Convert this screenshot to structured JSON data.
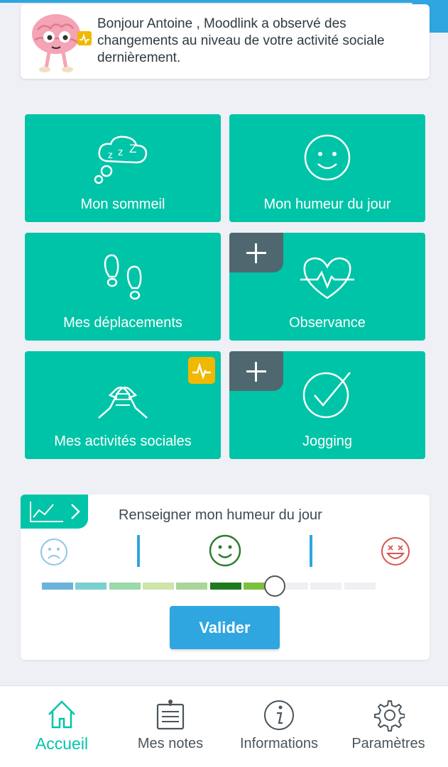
{
  "notification": {
    "message": "Bonjour Antoine , Moodlink a observé des changements au niveau de votre activité sociale dernièrement."
  },
  "tiles": [
    {
      "label": "Mon sommeil",
      "icon": "sleep-cloud-icon",
      "badge": null
    },
    {
      "label": "Mon humeur du jour",
      "icon": "smiley-icon",
      "badge": null
    },
    {
      "label": "Mes déplacements",
      "icon": "footprints-icon",
      "badge": null
    },
    {
      "label": "Observance",
      "icon": "heartbeat-icon",
      "badge": "plus"
    },
    {
      "label": "Mes activités sociales",
      "icon": "handshake-icon",
      "badge": "alert"
    },
    {
      "label": "Jogging",
      "icon": "checkmark-circle-icon",
      "badge": "plus"
    }
  ],
  "mood": {
    "title": "Renseigner mon humeur du jour",
    "scale_icons": [
      "sad-face-icon",
      "neutral-smile-icon",
      "happy-face-icon"
    ],
    "segment_colors": [
      "#6bb3dc",
      "#7ccfd0",
      "#9ad9a8",
      "#cde5a8",
      "#a8d59a",
      "#1f7a1f",
      "#7dc03c",
      "#eef0f4",
      "#eef0f4",
      "#eef0f4"
    ],
    "filled_segments": 7,
    "total_segments": 10,
    "value_fraction": 0.66,
    "submit_label": "Valider"
  },
  "nav": [
    {
      "label": "Accueil",
      "icon": "home-icon",
      "active": true
    },
    {
      "label": "Mes notes",
      "icon": "notes-icon",
      "active": false
    },
    {
      "label": "Informations",
      "icon": "info-icon",
      "active": false
    },
    {
      "label": "Paramètres",
      "icon": "gear-icon",
      "active": false
    }
  ],
  "colors": {
    "accent": "#00c4a7",
    "primary": "#2fa6e0",
    "badge_dark": "#4f6870",
    "alert": "#f0b800"
  }
}
